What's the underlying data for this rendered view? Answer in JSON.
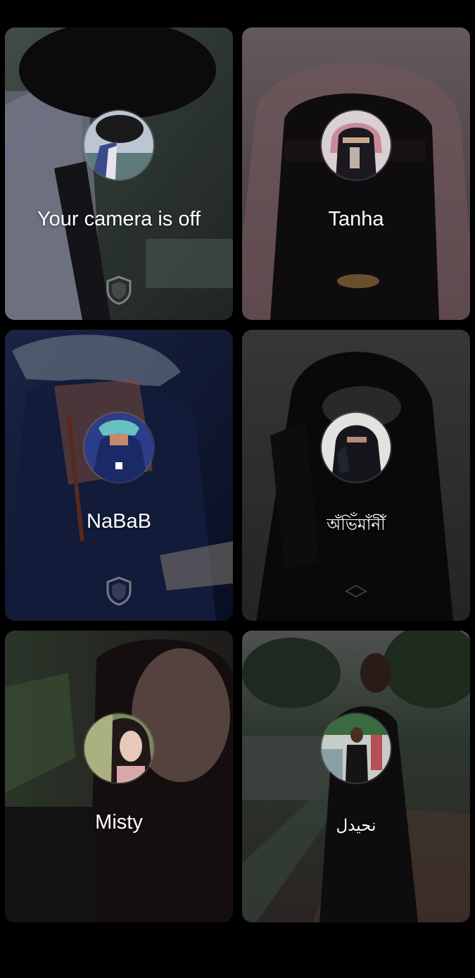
{
  "tiles": [
    {
      "id": "self",
      "name": "Your camera is off",
      "avatar_icon": "person-avatar-icon",
      "bg_colors": [
        "#4a5a55",
        "#8a8e9a",
        "#3e4b44"
      ],
      "shield_visible": true
    },
    {
      "id": "tanha",
      "name": "Tanha",
      "avatar_icon": "person-avatar-icon",
      "bg_colors": [
        "#7a6d72",
        "#2a2226",
        "#a89a98"
      ],
      "shield_visible": false
    },
    {
      "id": "nabab",
      "name": "NaBaB",
      "avatar_icon": "person-avatar-icon",
      "bg_colors": [
        "#1a2442",
        "#2a3a66",
        "#0e1328"
      ],
      "shield_visible": true
    },
    {
      "id": "obhimani",
      "name": "অঁভিঁমাঁনীঁ",
      "avatar_icon": "person-avatar-icon",
      "bg_colors": [
        "#3a3a3a",
        "#141414",
        "#4a4a48"
      ],
      "shield_visible": true
    },
    {
      "id": "misty",
      "name": "Misty",
      "avatar_icon": "person-avatar-icon",
      "bg_colors": [
        "#3a3c36",
        "#5a4c46",
        "#202020"
      ],
      "shield_visible": false
    },
    {
      "id": "nahidul",
      "name": "نحيدل",
      "avatar_icon": "person-avatar-icon",
      "bg_colors": [
        "#3c4a3e",
        "#4a4444",
        "#2a2c2a"
      ],
      "shield_visible": false
    }
  ]
}
